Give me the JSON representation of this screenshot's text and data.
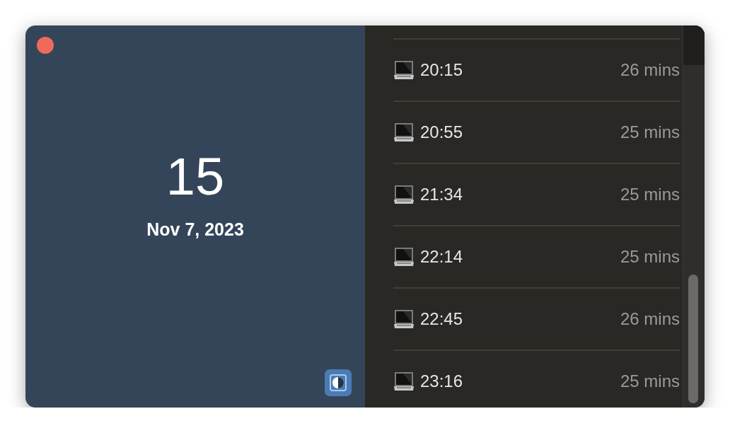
{
  "summary": {
    "count": "15",
    "date": "Nov 7, 2023"
  },
  "sessions": [
    {
      "time": "20:15",
      "duration": "26 mins"
    },
    {
      "time": "20:55",
      "duration": "25 mins"
    },
    {
      "time": "21:34",
      "duration": "25 mins"
    },
    {
      "time": "22:14",
      "duration": "25 mins"
    },
    {
      "time": "22:45",
      "duration": "26 mins"
    },
    {
      "time": "23:16",
      "duration": "25 mins"
    }
  ]
}
